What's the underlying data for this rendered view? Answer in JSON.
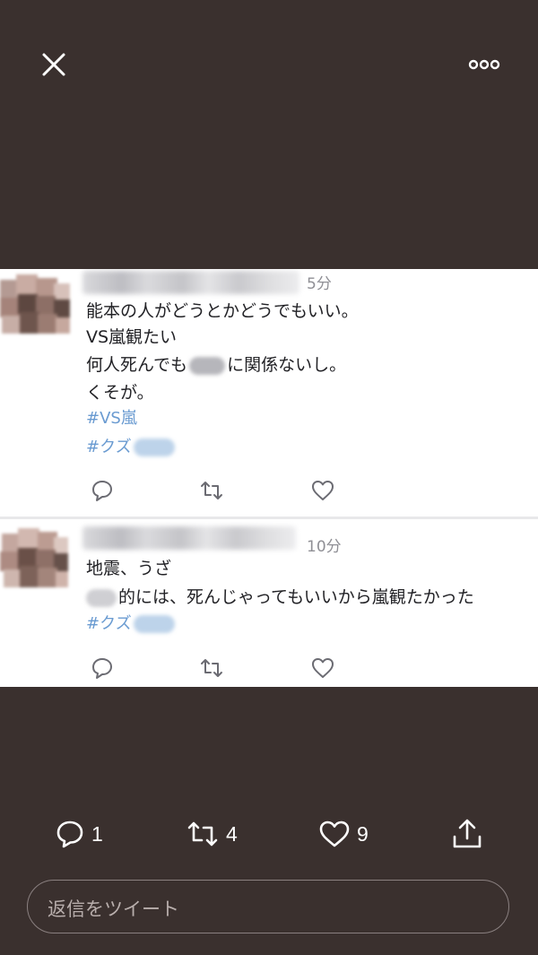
{
  "top_bar": {
    "close_icon": "close-icon",
    "more_icon": "more-horizontal-icon"
  },
  "media": {
    "tweets": [
      {
        "time": "5分",
        "lines": [
          "能本の人がどうとかどうでもいい。",
          "VS嵐観たい",
          "何人死んでも",
          "に関係ないし。",
          "くそが。"
        ],
        "hashtags": [
          "#VS嵐",
          "#クズ"
        ]
      },
      {
        "time": "10分",
        "lines": [
          "地震、うざ",
          "的には、死んじゃってもいいから嵐観たかった"
        ],
        "hashtags": [
          "#クズ"
        ]
      }
    ],
    "colors": {
      "hashtag": "#6a9bd1",
      "text": "#222226",
      "time": "#8f8f95"
    }
  },
  "actions": {
    "reply_count": "1",
    "retweet_count": "4",
    "like_count": "9",
    "share_icon": "share-icon"
  },
  "reply": {
    "placeholder": "返信をツイート"
  },
  "colors": {
    "background": "#3a302e",
    "foreground": "#ffffff"
  }
}
